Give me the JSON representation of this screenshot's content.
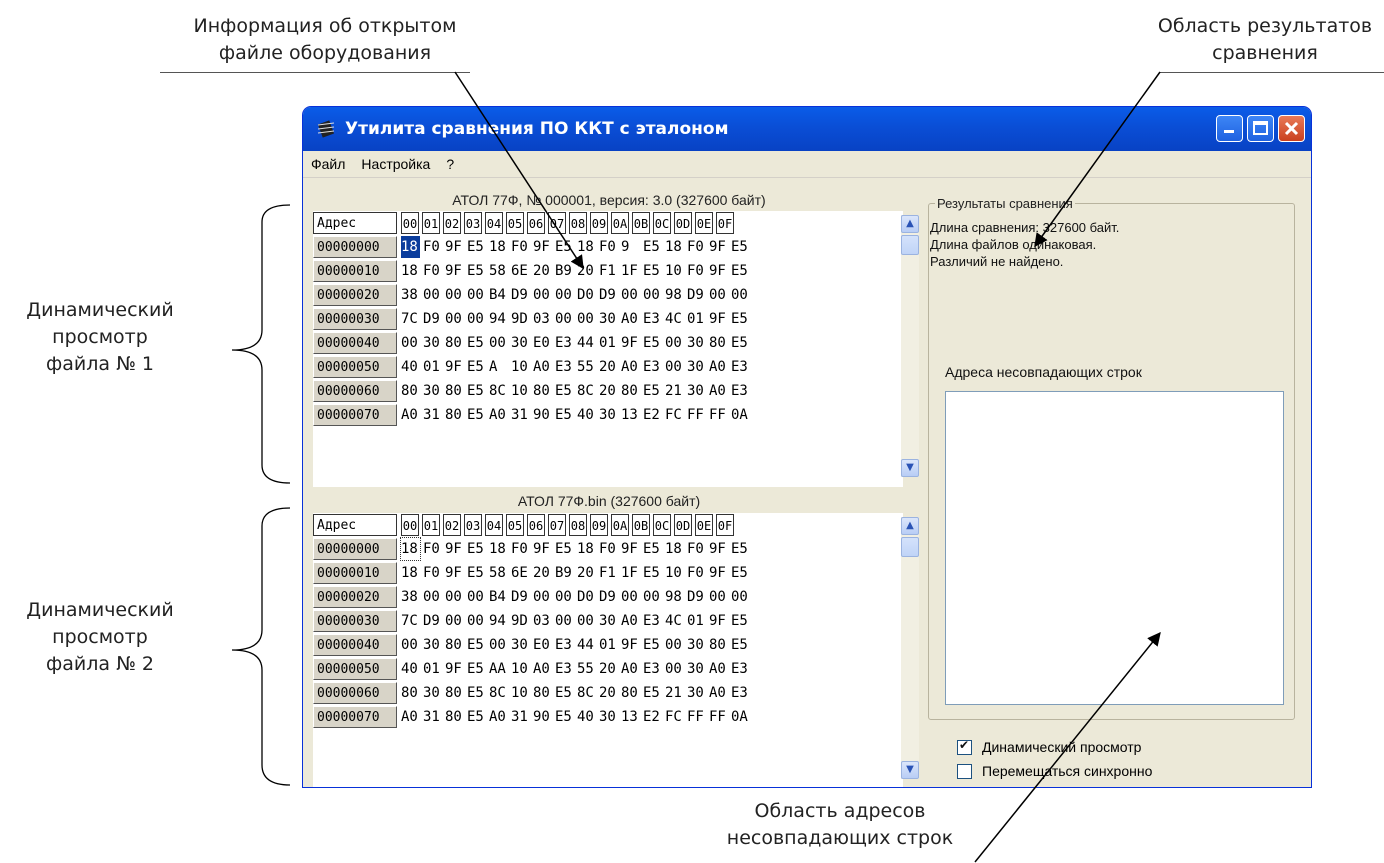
{
  "callouts": {
    "info_line1": "Информация об открытом",
    "info_line2": "файле оборудования",
    "results_line1": "Область результатов",
    "results_line2": "сравнения",
    "dyn1_line1": "Динамический",
    "dyn1_line2": "просмотр",
    "dyn1_line3": "файла № 1",
    "dyn2_line1": "Динамический",
    "dyn2_line2": "просмотр",
    "dyn2_line3": "файла № 2",
    "addr_line1": "Область адресов",
    "addr_line2": "несовпадающих строк"
  },
  "window": {
    "title": "Утилита сравнения ПО ККТ с эталоном",
    "menu": [
      "Файл",
      "Настройка",
      "?"
    ]
  },
  "file1": {
    "header": "АТОЛ 77Ф, № 000001, версия: 3.0 (327600 байт)",
    "addr_label": "Адрес",
    "columns": [
      "00",
      "01",
      "02",
      "03",
      "04",
      "05",
      "06",
      "07",
      "08",
      "09",
      "0A",
      "0B",
      "0C",
      "0D",
      "0E",
      "0F"
    ],
    "rows": [
      {
        "addr": "00000000",
        "bytes": [
          "18",
          "F0",
          "9F",
          "E5",
          "18",
          "F0",
          "9F",
          "E5",
          "18",
          "F0",
          "9",
          "E5",
          "18",
          "F0",
          "9F",
          "E5"
        ]
      },
      {
        "addr": "00000010",
        "bytes": [
          "18",
          "F0",
          "9F",
          "E5",
          "58",
          "6E",
          "20",
          "B9",
          "20",
          "F1",
          "1F",
          "E5",
          "10",
          "F0",
          "9F",
          "E5"
        ]
      },
      {
        "addr": "00000020",
        "bytes": [
          "38",
          "00",
          "00",
          "00",
          "B4",
          "D9",
          "00",
          "00",
          "D0",
          "D9",
          "00",
          "00",
          "98",
          "D9",
          "00",
          "00"
        ]
      },
      {
        "addr": "00000030",
        "bytes": [
          "7C",
          "D9",
          "00",
          "00",
          "94",
          "9D",
          "03",
          "00",
          "00",
          "30",
          "A0",
          "E3",
          "4C",
          "01",
          "9F",
          "E5"
        ]
      },
      {
        "addr": "00000040",
        "bytes": [
          "00",
          "30",
          "80",
          "E5",
          "00",
          "30",
          "E0",
          "E3",
          "44",
          "01",
          "9F",
          "E5",
          "00",
          "30",
          "80",
          "E5"
        ]
      },
      {
        "addr": "00000050",
        "bytes": [
          "40",
          "01",
          "9F",
          "E5",
          "A",
          "10",
          "A0",
          "E3",
          "55",
          "20",
          "A0",
          "E3",
          "00",
          "30",
          "A0",
          "E3"
        ]
      },
      {
        "addr": "00000060",
        "bytes": [
          "80",
          "30",
          "80",
          "E5",
          "8C",
          "10",
          "80",
          "E5",
          "8C",
          "20",
          "80",
          "E5",
          "21",
          "30",
          "A0",
          "E3"
        ]
      },
      {
        "addr": "00000070",
        "bytes": [
          "A0",
          "31",
          "80",
          "E5",
          "A0",
          "31",
          "90",
          "E5",
          "40",
          "30",
          "13",
          "E2",
          "FC",
          "FF",
          "FF",
          "0A"
        ]
      }
    ]
  },
  "file2": {
    "header": "АТОЛ 77Ф.bin (327600 байт)",
    "addr_label": "Адрес",
    "columns": [
      "00",
      "01",
      "02",
      "03",
      "04",
      "05",
      "06",
      "07",
      "08",
      "09",
      "0A",
      "0B",
      "0C",
      "0D",
      "0E",
      "0F"
    ],
    "rows": [
      {
        "addr": "00000000",
        "bytes": [
          "18",
          "F0",
          "9F",
          "E5",
          "18",
          "F0",
          "9F",
          "E5",
          "18",
          "F0",
          "9F",
          "E5",
          "18",
          "F0",
          "9F",
          "E5"
        ]
      },
      {
        "addr": "00000010",
        "bytes": [
          "18",
          "F0",
          "9F",
          "E5",
          "58",
          "6E",
          "20",
          "B9",
          "20",
          "F1",
          "1F",
          "E5",
          "10",
          "F0",
          "9F",
          "E5"
        ]
      },
      {
        "addr": "00000020",
        "bytes": [
          "38",
          "00",
          "00",
          "00",
          "B4",
          "D9",
          "00",
          "00",
          "D0",
          "D9",
          "00",
          "00",
          "98",
          "D9",
          "00",
          "00"
        ]
      },
      {
        "addr": "00000030",
        "bytes": [
          "7C",
          "D9",
          "00",
          "00",
          "94",
          "9D",
          "03",
          "00",
          "00",
          "30",
          "A0",
          "E3",
          "4C",
          "01",
          "9F",
          "E5"
        ]
      },
      {
        "addr": "00000040",
        "bytes": [
          "00",
          "30",
          "80",
          "E5",
          "00",
          "30",
          "E0",
          "E3",
          "44",
          "01",
          "9F",
          "E5",
          "00",
          "30",
          "80",
          "E5"
        ]
      },
      {
        "addr": "00000050",
        "bytes": [
          "40",
          "01",
          "9F",
          "E5",
          "AA",
          "10",
          "A0",
          "E3",
          "55",
          "20",
          "A0",
          "E3",
          "00",
          "30",
          "A0",
          "E3"
        ]
      },
      {
        "addr": "00000060",
        "bytes": [
          "80",
          "30",
          "80",
          "E5",
          "8C",
          "10",
          "80",
          "E5",
          "8C",
          "20",
          "80",
          "E5",
          "21",
          "30",
          "A0",
          "E3"
        ]
      },
      {
        "addr": "00000070",
        "bytes": [
          "A0",
          "31",
          "80",
          "E5",
          "A0",
          "31",
          "90",
          "E5",
          "40",
          "30",
          "13",
          "E2",
          "FC",
          "FF",
          "FF",
          "0A"
        ]
      }
    ]
  },
  "results": {
    "group_title": "Результаты сравнения",
    "line1": "Длина сравнения: 327600 байт.",
    "line2": "Длина файлов одинаковая.",
    "line3": "Различий не найдено.",
    "mismatch_label": "Адреса несовпадающих строк"
  },
  "options": {
    "dynamic_view": {
      "label": "Динамический просмотр",
      "checked": true
    },
    "sync_move": {
      "label": "Перемещаться синхронно",
      "checked": false
    }
  }
}
